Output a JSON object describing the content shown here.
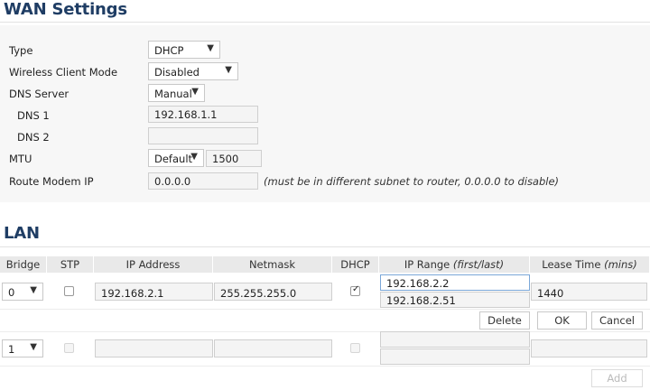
{
  "wan": {
    "title": "WAN Settings",
    "type": {
      "label": "Type",
      "value": "DHCP"
    },
    "wireless_client_mode": {
      "label": "Wireless Client Mode",
      "value": "Disabled"
    },
    "dns_server": {
      "label": "DNS Server",
      "value": "Manual"
    },
    "dns1": {
      "label": "DNS 1",
      "value": "192.168.1.1"
    },
    "dns2": {
      "label": "DNS 2",
      "value": ""
    },
    "mtu": {
      "label": "MTU",
      "mode": "Default",
      "value": "1500"
    },
    "route_modem_ip": {
      "label": "Route Modem IP",
      "value": "0.0.0.0",
      "hint": "(must be in different subnet to router, 0.0.0.0 to disable)"
    }
  },
  "lan": {
    "title": "LAN",
    "columns": {
      "bridge": "Bridge",
      "stp": "STP",
      "ip_address": "IP Address",
      "netmask": "Netmask",
      "dhcp": "DHCP",
      "ip_range": "IP Range",
      "ip_range_sub": "(first/last)",
      "lease_time": "Lease Time",
      "lease_time_sub": "(mins)"
    },
    "row": {
      "bridge": "0",
      "stp": false,
      "ip_address": "192.168.2.1",
      "netmask": "255.255.255.0",
      "dhcp": true,
      "ip_first": "192.168.2.2",
      "ip_last": "192.168.2.51",
      "lease": "1440"
    },
    "row_buttons": {
      "delete": "Delete",
      "ok": "OK",
      "cancel": "Cancel"
    },
    "new_row": {
      "bridge": "1",
      "ip_address": "",
      "netmask": "",
      "ip_first": "",
      "ip_last": "",
      "lease": ""
    },
    "add_button": "Add"
  },
  "icons": {
    "dropdown": "chevron-down-icon",
    "checkbox": "checkbox-icon"
  }
}
